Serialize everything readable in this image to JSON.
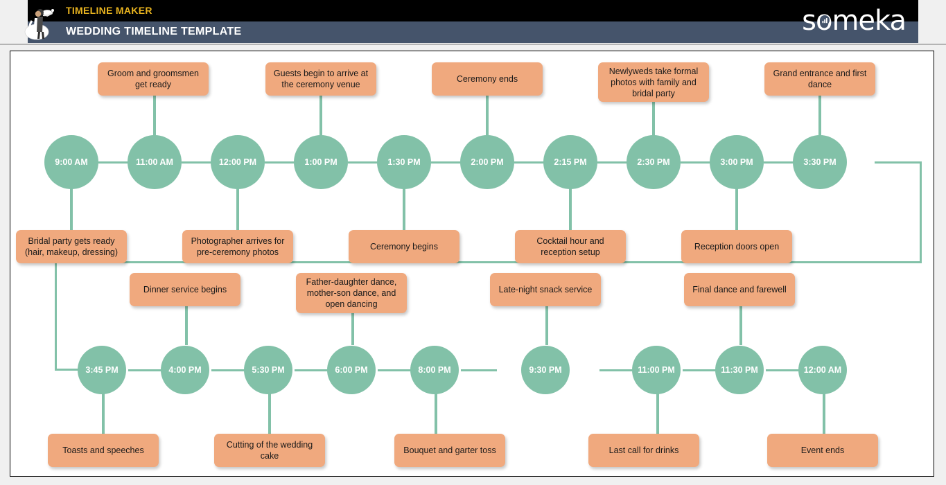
{
  "header": {
    "brand_sub": "TIMELINE MAKER",
    "brand_title": "WEDDING TIMELINE TEMPLATE",
    "logo_text": "someka",
    "logo_o_left": "s",
    "logo_o_right": "meka",
    "colors": {
      "band_top": "#000000",
      "band_bottom": "#45546b",
      "brand_sub": "#e8b31f",
      "brand_title": "#ffffff"
    }
  },
  "theme": {
    "node_fill": "#82c1a8",
    "node_text": "#ffffff",
    "label_fill": "#f0a97e",
    "label_text": "#1a1a1a",
    "connector": "#82c1a8",
    "canvas": "#ffffff",
    "page_background": "#f0f0f0"
  },
  "timeline": {
    "row1": [
      {
        "time": "9:00 AM",
        "event": "Bridal party gets ready (hair, makeup, dressing)",
        "side": "below"
      },
      {
        "time": "11:00 AM",
        "event": "Groom and groomsmen get ready",
        "side": "above"
      },
      {
        "time": "12:00 PM",
        "event": "Photographer arrives for pre-ceremony photos",
        "side": "below"
      },
      {
        "time": "1:00 PM",
        "event": "Guests begin to arrive at the ceremony venue",
        "side": "above"
      },
      {
        "time": "1:30 PM",
        "event": "Ceremony begins",
        "side": "below"
      },
      {
        "time": "2:00 PM",
        "event": "Ceremony ends",
        "side": "above"
      },
      {
        "time": "2:15 PM",
        "event": "Cocktail hour and reception setup",
        "side": "below"
      },
      {
        "time": "2:30 PM",
        "event": "Newlyweds take formal photos with family and bridal party",
        "side": "above"
      },
      {
        "time": "3:00 PM",
        "event": "Reception doors open",
        "side": "below"
      },
      {
        "time": "3:30 PM",
        "event": "Grand entrance and first dance",
        "side": "above"
      }
    ],
    "row2": [
      {
        "time": "3:45 PM",
        "event": "Toasts and speeches",
        "side": "below"
      },
      {
        "time": "4:00 PM",
        "event": "Dinner service begins",
        "side": "above"
      },
      {
        "time": "5:30 PM",
        "event": "Cutting of the wedding cake",
        "side": "below"
      },
      {
        "time": "6:00 PM",
        "event": "Father-daughter dance, mother-son dance, and open dancing",
        "side": "above"
      },
      {
        "time": "8:00 PM",
        "event": "Bouquet and garter toss",
        "side": "below"
      },
      {
        "time": "9:30 PM",
        "event": "Late-night snack service",
        "side": "above"
      },
      {
        "time": "11:00 PM",
        "event": "Last call for drinks",
        "side": "below"
      },
      {
        "time": "11:30 PM",
        "event": "Final dance and farewell",
        "side": "above"
      },
      {
        "time": "12:00 AM",
        "event": "Event ends",
        "side": "below"
      }
    ]
  }
}
